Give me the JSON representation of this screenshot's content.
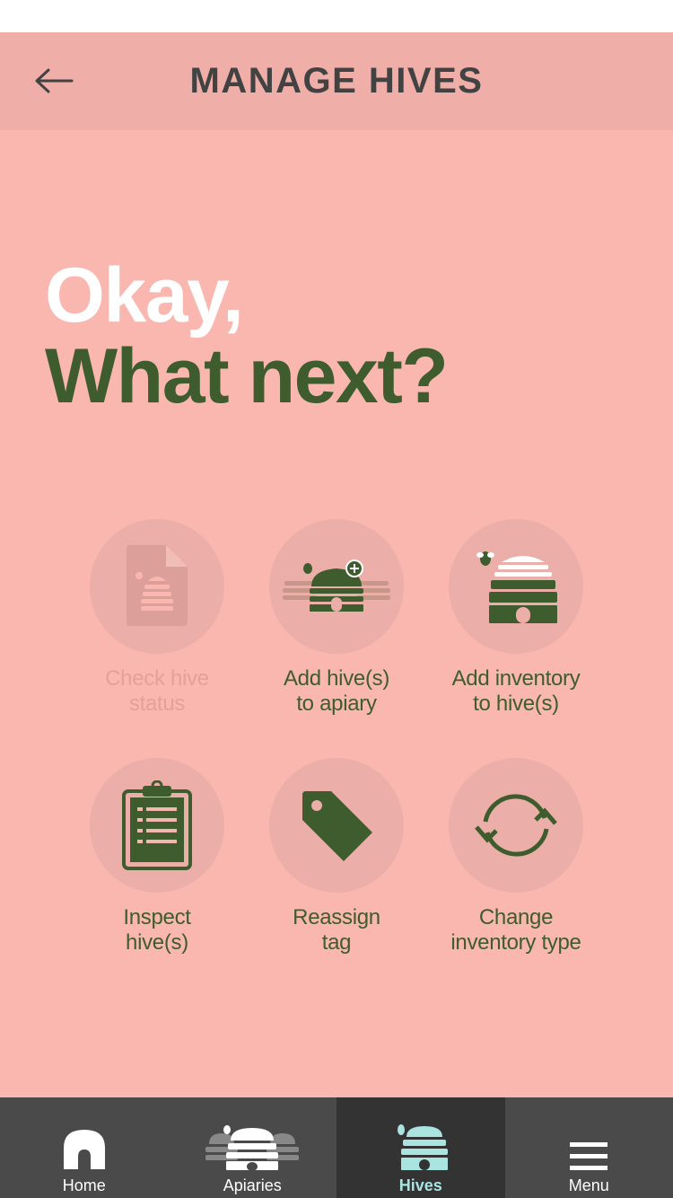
{
  "header": {
    "title": "MANAGE HIVES",
    "back_icon": "arrow-left-icon"
  },
  "headline": {
    "line1": "Okay,",
    "line2": "What next?"
  },
  "actions": [
    {
      "line1": "Check hive",
      "line2": "status",
      "icon": "hive-status-document-icon",
      "enabled": false
    },
    {
      "line1": "Add hive(s)",
      "line2": "to apiary",
      "icon": "add-hive-to-apiary-icon",
      "enabled": true
    },
    {
      "line1": "Add inventory",
      "line2": "to hive(s)",
      "icon": "add-inventory-hive-icon",
      "enabled": true
    },
    {
      "line1": "Inspect",
      "line2": "hive(s)",
      "icon": "clipboard-icon",
      "enabled": true
    },
    {
      "line1": "Reassign",
      "line2": "tag",
      "icon": "tag-icon",
      "enabled": true
    },
    {
      "line1": "Change",
      "line2": "inventory type",
      "icon": "refresh-cycle-icon",
      "enabled": true
    }
  ],
  "tabs": [
    {
      "label": "Home",
      "icon": "home-icon",
      "active": false
    },
    {
      "label": "Apiaries",
      "icon": "apiaries-icon",
      "active": false
    },
    {
      "label": "Hives",
      "icon": "hive-icon",
      "active": true
    },
    {
      "label": "Menu",
      "icon": "hamburger-menu-icon",
      "active": false
    }
  ],
  "colors": {
    "background": "#fab7af",
    "header_bg": "#efaea8",
    "circle_bg": "#ecaea8",
    "accent_green": "#3e5c2e",
    "disabled_text": "#e3a19b",
    "title_text": "#424242",
    "tabbar_bg": "#4a4a4a",
    "tab_active_bg": "#333333",
    "tab_active_text": "#a9e4e0"
  }
}
